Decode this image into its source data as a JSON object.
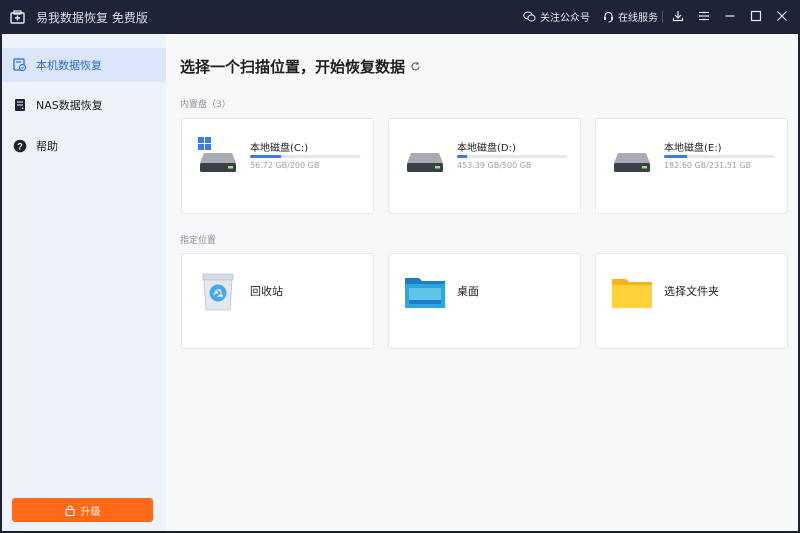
{
  "window": {
    "title": "易我数据恢复 免费版",
    "follow_label": "关注公众号",
    "online_label": "在线服务"
  },
  "sidebar": {
    "items": [
      {
        "label": "本机数据恢复",
        "icon": "local-recovery-icon",
        "active": true
      },
      {
        "label": "NAS数据恢复",
        "icon": "nas-icon",
        "active": false
      },
      {
        "label": "帮助",
        "icon": "help-icon",
        "active": false
      }
    ],
    "upgrade_label": "升级"
  },
  "main": {
    "heading": "选择一个扫描位置，开始恢复数据",
    "internal_label": "内置盘（3）",
    "drives": [
      {
        "name": "本地磁盘(C:)",
        "size": "56.72 GB/200 GB",
        "used_fraction": 0.28,
        "windows_logo": true
      },
      {
        "name": "本地磁盘(D:)",
        "size": "453.39 GB/500 GB",
        "used_fraction": 0.09,
        "windows_logo": false
      },
      {
        "name": "本地磁盘(E:)",
        "size": "182.60 GB/231.51 GB",
        "used_fraction": 0.21,
        "windows_logo": false
      }
    ],
    "location_label": "指定位置",
    "locations": [
      {
        "name": "回收站",
        "icon": "recycle-bin-icon"
      },
      {
        "name": "桌面",
        "icon": "desktop-folder-icon"
      },
      {
        "name": "选择文件夹",
        "icon": "folder-icon"
      }
    ]
  },
  "colors": {
    "titlebar": "#1d2438",
    "accent": "#3a7bf0",
    "upgrade": "#ff6a1a",
    "sidebar": "#eef2f9"
  }
}
